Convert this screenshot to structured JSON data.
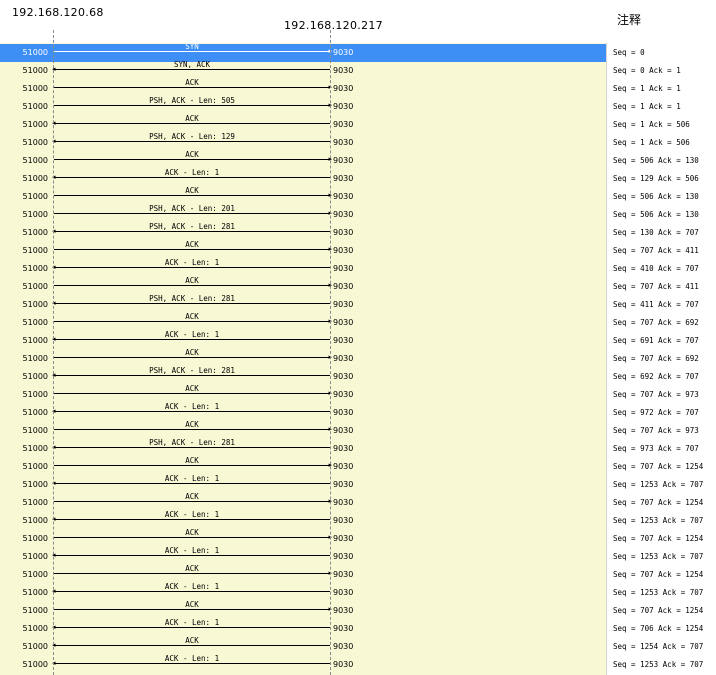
{
  "header": {
    "left_host": "192.168.120.68",
    "right_host": "192.168.120.217",
    "notes_title": "注释"
  },
  "flows": [
    {
      "left_port": "51000",
      "right_port": "9030",
      "label": "SYN",
      "dir": "right",
      "note": "Seq = 0",
      "selected": true
    },
    {
      "left_port": "51000",
      "right_port": "9030",
      "label": "SYN, ACK",
      "dir": "left",
      "note": "Seq = 0 Ack = 1"
    },
    {
      "left_port": "51000",
      "right_port": "9030",
      "label": "ACK",
      "dir": "right",
      "note": "Seq = 1 Ack = 1"
    },
    {
      "left_port": "51000",
      "right_port": "9030",
      "label": "PSH, ACK - Len: 505",
      "dir": "right",
      "note": "Seq = 1 Ack = 1"
    },
    {
      "left_port": "51000",
      "right_port": "9030",
      "label": "ACK",
      "dir": "left",
      "note": "Seq = 1 Ack = 506"
    },
    {
      "left_port": "51000",
      "right_port": "9030",
      "label": "PSH, ACK - Len: 129",
      "dir": "left",
      "note": "Seq = 1 Ack = 506"
    },
    {
      "left_port": "51000",
      "right_port": "9030",
      "label": "ACK",
      "dir": "right",
      "note": "Seq = 506 Ack = 130"
    },
    {
      "left_port": "51000",
      "right_port": "9030",
      "label": "ACK - Len: 1",
      "dir": "left",
      "note": "Seq = 129 Ack = 506"
    },
    {
      "left_port": "51000",
      "right_port": "9030",
      "label": "ACK",
      "dir": "right",
      "note": "Seq = 506 Ack = 130"
    },
    {
      "left_port": "51000",
      "right_port": "9030",
      "label": "PSH, ACK - Len: 201",
      "dir": "right",
      "note": "Seq = 506 Ack = 130"
    },
    {
      "left_port": "51000",
      "right_port": "9030",
      "label": "PSH, ACK - Len: 281",
      "dir": "left",
      "note": "Seq = 130 Ack = 707"
    },
    {
      "left_port": "51000",
      "right_port": "9030",
      "label": "ACK",
      "dir": "right",
      "note": "Seq = 707 Ack = 411"
    },
    {
      "left_port": "51000",
      "right_port": "9030",
      "label": "ACK - Len: 1",
      "dir": "left",
      "note": "Seq = 410 Ack = 707"
    },
    {
      "left_port": "51000",
      "right_port": "9030",
      "label": "ACK",
      "dir": "right",
      "note": "Seq = 707 Ack = 411"
    },
    {
      "left_port": "51000",
      "right_port": "9030",
      "label": "PSH, ACK - Len: 281",
      "dir": "left",
      "note": "Seq = 411 Ack = 707"
    },
    {
      "left_port": "51000",
      "right_port": "9030",
      "label": "ACK",
      "dir": "right",
      "note": "Seq = 707 Ack = 692"
    },
    {
      "left_port": "51000",
      "right_port": "9030",
      "label": "ACK - Len: 1",
      "dir": "left",
      "note": "Seq = 691 Ack = 707"
    },
    {
      "left_port": "51000",
      "right_port": "9030",
      "label": "ACK",
      "dir": "right",
      "note": "Seq = 707 Ack = 692"
    },
    {
      "left_port": "51000",
      "right_port": "9030",
      "label": "PSH, ACK - Len: 281",
      "dir": "left",
      "note": "Seq = 692 Ack = 707"
    },
    {
      "left_port": "51000",
      "right_port": "9030",
      "label": "ACK",
      "dir": "right",
      "note": "Seq = 707 Ack = 973"
    },
    {
      "left_port": "51000",
      "right_port": "9030",
      "label": "ACK - Len: 1",
      "dir": "left",
      "note": "Seq = 972 Ack = 707"
    },
    {
      "left_port": "51000",
      "right_port": "9030",
      "label": "ACK",
      "dir": "right",
      "note": "Seq = 707 Ack = 973"
    },
    {
      "left_port": "51000",
      "right_port": "9030",
      "label": "PSH, ACK - Len: 281",
      "dir": "left",
      "note": "Seq = 973 Ack = 707"
    },
    {
      "left_port": "51000",
      "right_port": "9030",
      "label": "ACK",
      "dir": "right",
      "note": "Seq = 707 Ack = 1254"
    },
    {
      "left_port": "51000",
      "right_port": "9030",
      "label": "ACK - Len: 1",
      "dir": "left",
      "note": "Seq = 1253 Ack = 707"
    },
    {
      "left_port": "51000",
      "right_port": "9030",
      "label": "ACK",
      "dir": "right",
      "note": "Seq = 707 Ack = 1254"
    },
    {
      "left_port": "51000",
      "right_port": "9030",
      "label": "ACK - Len: 1",
      "dir": "left",
      "note": "Seq = 1253 Ack = 707"
    },
    {
      "left_port": "51000",
      "right_port": "9030",
      "label": "ACK",
      "dir": "right",
      "note": "Seq = 707 Ack = 1254"
    },
    {
      "left_port": "51000",
      "right_port": "9030",
      "label": "ACK - Len: 1",
      "dir": "left",
      "note": "Seq = 1253 Ack = 707"
    },
    {
      "left_port": "51000",
      "right_port": "9030",
      "label": "ACK",
      "dir": "right",
      "note": "Seq = 707 Ack = 1254"
    },
    {
      "left_port": "51000",
      "right_port": "9030",
      "label": "ACK - Len: 1",
      "dir": "left",
      "note": "Seq = 1253 Ack = 707"
    },
    {
      "left_port": "51000",
      "right_port": "9030",
      "label": "ACK",
      "dir": "right",
      "note": "Seq = 707 Ack = 1254"
    },
    {
      "left_port": "51000",
      "right_port": "9030",
      "label": "ACK - Len: 1",
      "dir": "left",
      "note": "Seq = 706 Ack = 1254"
    },
    {
      "left_port": "51000",
      "right_port": "9030",
      "label": "ACK",
      "dir": "left",
      "note": "Seq = 1254 Ack = 707"
    },
    {
      "left_port": "51000",
      "right_port": "9030",
      "label": "ACK - Len: 1",
      "dir": "left",
      "note": "Seq = 1253 Ack = 707"
    }
  ]
}
